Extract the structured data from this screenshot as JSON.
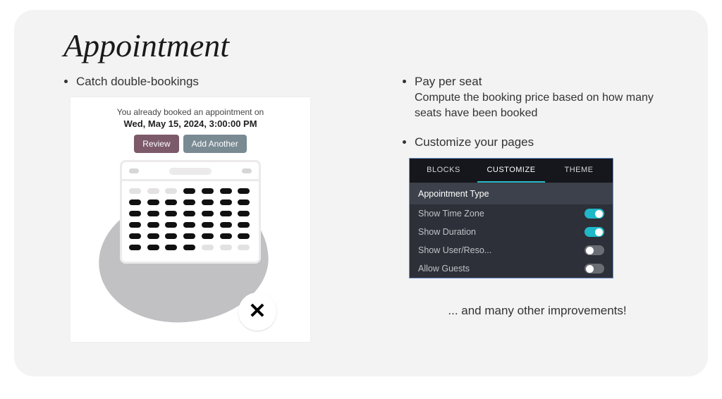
{
  "title": "Appointment",
  "left": {
    "bullet": "Catch double-bookings",
    "card": {
      "message": "You already booked an appointment on",
      "date": "Wed, May 15, 2024, 3:00:00 PM",
      "review_label": "Review",
      "add_label": "Add Another",
      "x_symbol": "✕"
    }
  },
  "right": {
    "bullets": [
      {
        "label": "Pay per seat",
        "desc": "Compute the booking price based on how many seats have been booked"
      },
      {
        "label": "Customize your pages",
        "desc": ""
      }
    ],
    "panel": {
      "tabs": [
        "BLOCKS",
        "CUSTOMIZE",
        "THEME"
      ],
      "active_tab_index": 1,
      "header": "Appointment Type",
      "rows": [
        {
          "label": "Show Time Zone",
          "on": true
        },
        {
          "label": "Show Duration",
          "on": true
        },
        {
          "label": "Show User/Reso...",
          "on": false
        },
        {
          "label": "Allow Guests",
          "on": false
        }
      ]
    },
    "footer": "... and many other improvements!"
  }
}
